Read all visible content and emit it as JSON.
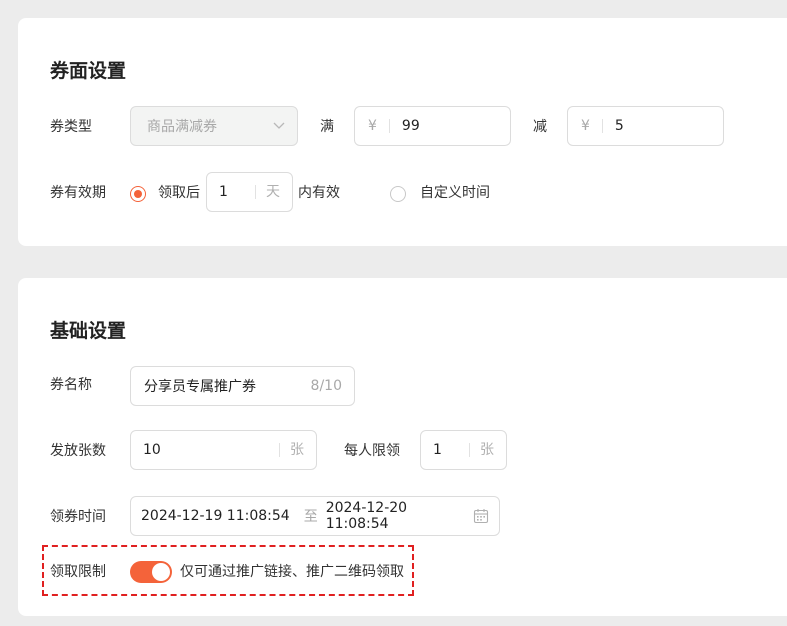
{
  "coupon_face": {
    "title": "券面设置",
    "type_label": "券类型",
    "type_value": "商品满减券",
    "full_label": "满",
    "currency": "¥",
    "full_value": "99",
    "minus_label": "减",
    "minus_value": "5",
    "validity_label": "券有效期",
    "option_after": "领取后",
    "days_value": "1",
    "days_unit": "天",
    "valid_within": "内有效",
    "option_custom": "自定义时间"
  },
  "basic": {
    "title": "基础设置",
    "name_label": "券名称",
    "name_value": "分享员专属推广券",
    "name_count": "8/10",
    "issue_label": "发放张数",
    "issue_value": "10",
    "unit_zhang": "张",
    "limit_label": "每人限领",
    "limit_value": "1",
    "time_label": "领券时间",
    "time_start": "2024-12-19 11:08:54",
    "time_sep": "至",
    "time_end": "2024-12-20 11:08:54",
    "restrict_label": "领取限制",
    "restrict_text": "仅可通过推广链接、推广二维码领取"
  },
  "colors": {
    "accent": "#f4633a",
    "highlight": "#e02020"
  }
}
